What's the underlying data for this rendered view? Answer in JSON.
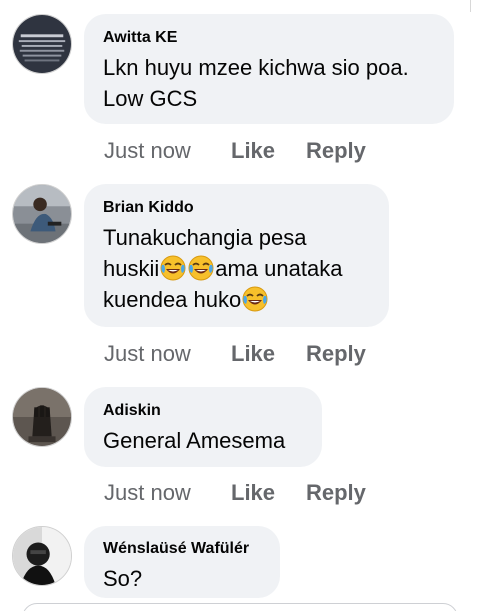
{
  "comments": [
    {
      "author": "Awitta KE",
      "text_lines": [
        "Lkn huyu mzee kichwa sio poa.",
        "Low GCS"
      ],
      "time": "Just now",
      "like": "Like",
      "reply": "Reply"
    },
    {
      "author": "Brian Kiddo",
      "line1": "Tunakuchangia pesa",
      "line2a": "huskii",
      "line2b": "ama unataka",
      "line3": "kuendea huko",
      "emoji": "face-with-tears-of-joy-icon",
      "time": "Just now",
      "like": "Like",
      "reply": "Reply"
    },
    {
      "author": "Adiskin",
      "text": "General Amesema",
      "time": "Just now",
      "like": "Like",
      "reply": "Reply"
    },
    {
      "author": "Wénslaüsé Wafülér",
      "text": "So?"
    }
  ],
  "colors": {
    "bubble": "#f0f2f5",
    "meta": "#65676b",
    "text": "#050505"
  }
}
